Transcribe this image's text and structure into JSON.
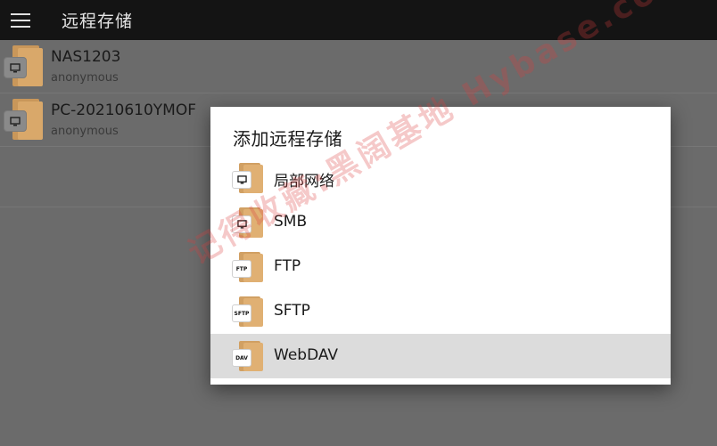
{
  "appbar": {
    "title": "远程存储"
  },
  "list": {
    "items": [
      {
        "name": "NAS1203",
        "sub": "anonymous",
        "icon": "monitor-icon"
      },
      {
        "name": "PC-20210610YMOF",
        "sub": "anonymous",
        "icon": "monitor-icon"
      }
    ]
  },
  "dialog": {
    "title": "添加远程存储",
    "options": [
      {
        "label": "局部网络",
        "icon": "monitor-icon",
        "badge": ""
      },
      {
        "label": "SMB",
        "icon": "monitor-icon",
        "badge": ""
      },
      {
        "label": "FTP",
        "icon": "ftp-icon",
        "badge": "FTP"
      },
      {
        "label": "SFTP",
        "icon": "sftp-icon",
        "badge": "SFTP"
      },
      {
        "label": "WebDAV",
        "icon": "dav-icon",
        "badge": "DAV"
      }
    ],
    "selected": "WebDAV"
  },
  "watermark": {
    "text": "记得收藏:黑阔基地 Hybase.com"
  },
  "colors": {
    "appbar": "#141414",
    "scrim": "#6b6b6b",
    "folder": "#d9a86a",
    "selected_row": "#dcdcdc"
  }
}
